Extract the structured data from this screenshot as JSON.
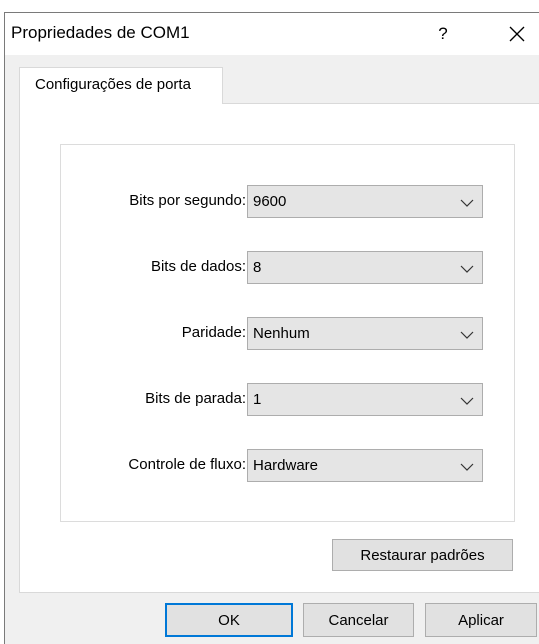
{
  "window": {
    "title": "Propriedades de COM1",
    "help_label": "?",
    "close_icon": "close-icon"
  },
  "tabs": [
    {
      "label": "Configurações de porta",
      "selected": true
    }
  ],
  "settings": [
    {
      "label": "Bits por segundo:",
      "value": "9600"
    },
    {
      "label": "Bits de dados:",
      "value": "8"
    },
    {
      "label": "Paridade:",
      "value": "Nenhum"
    },
    {
      "label": "Bits de parada:",
      "value": "1"
    },
    {
      "label": "Controle de fluxo:",
      "value": "Hardware"
    }
  ],
  "restore_label": "Restaurar padrões",
  "buttons": {
    "ok": "OK",
    "cancel": "Cancelar",
    "apply": "Aplicar"
  },
  "colors": {
    "accent": "#0078d7",
    "dialog_bg": "#f0f0f0",
    "panel_bg": "#ffffff"
  }
}
